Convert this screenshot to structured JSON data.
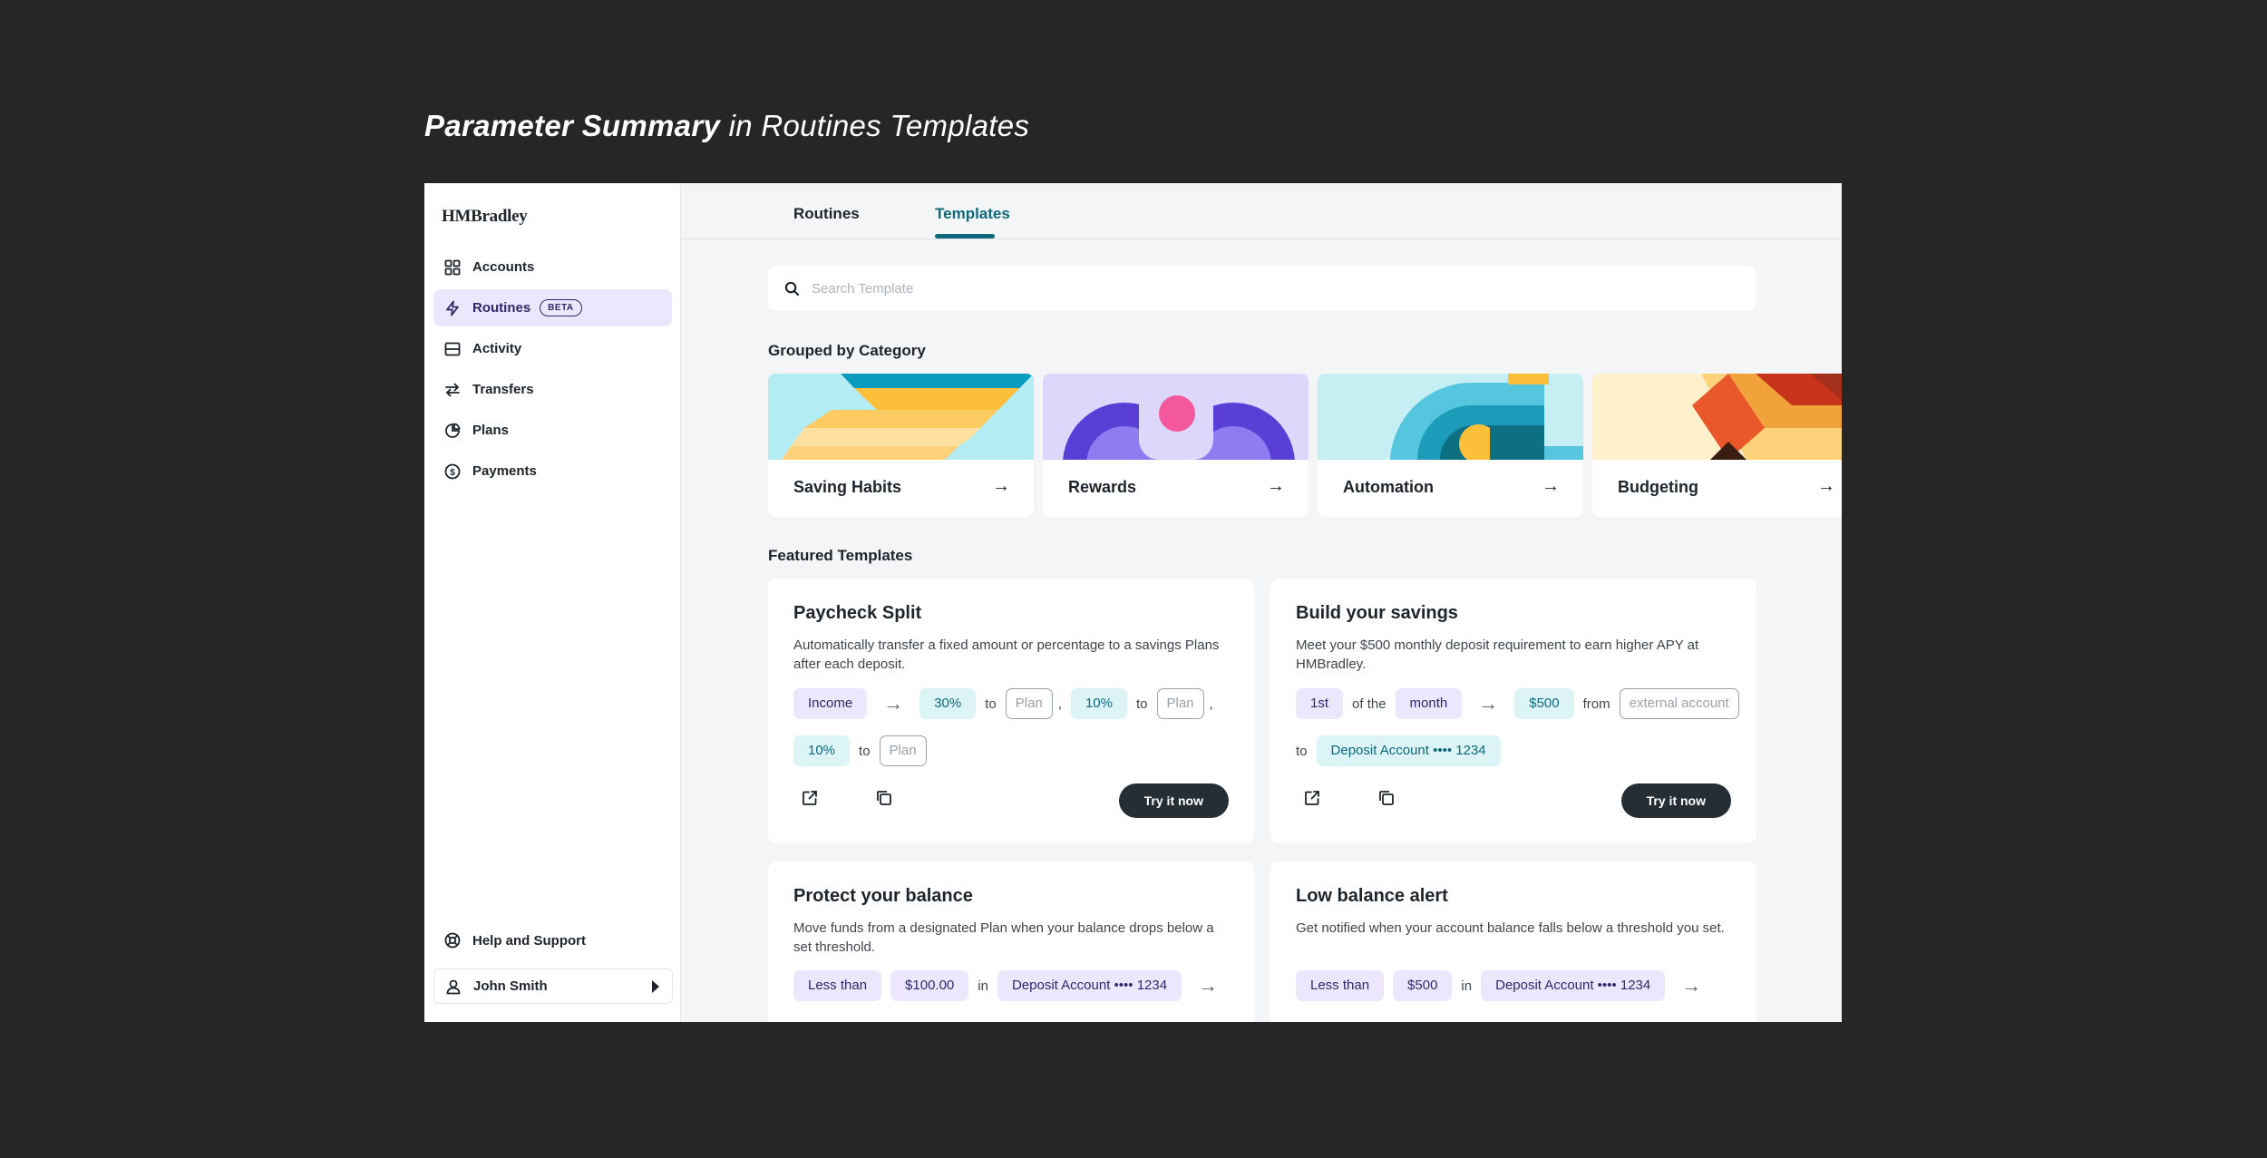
{
  "heading": {
    "strong": "Parameter Summary",
    "light": "in Routines Templates"
  },
  "sidebar": {
    "logo": "HMBradley",
    "items": [
      {
        "label": "Accounts",
        "icon": "grid-icon"
      },
      {
        "label": "Routines",
        "icon": "lightning-icon",
        "badge": "BETA"
      },
      {
        "label": "Activity",
        "icon": "card-icon"
      },
      {
        "label": "Transfers",
        "icon": "transfer-icon"
      },
      {
        "label": "Plans",
        "icon": "pie-icon"
      },
      {
        "label": "Payments",
        "icon": "dollar-circle-icon"
      }
    ],
    "help": "Help and Support",
    "user": "John Smith"
  },
  "tabs": [
    "Routines",
    "Templates"
  ],
  "search": {
    "placeholder": "Search Template"
  },
  "grouped": {
    "title": "Grouped by Category",
    "cards": [
      "Saving Habits",
      "Rewards",
      "Automation",
      "Budgeting"
    ]
  },
  "featured": {
    "title": "Featured Templates",
    "cards": [
      {
        "title": "Paycheck Split",
        "desc": "Automatically transfer a fixed amount or percentage to a savings Plans after each deposit.",
        "row1": [
          "Income",
          "30%",
          "to",
          "Plan",
          ",",
          "10%",
          "to",
          "Plan",
          ","
        ],
        "row2": [
          "10%",
          "to",
          "Plan"
        ],
        "button": "Try it now"
      },
      {
        "title": "Build your savings",
        "desc": "Meet your $500 monthly deposit requirement to earn higher APY at HMBradley.",
        "row1": [
          "1st",
          "of the",
          "month",
          "$500",
          "from",
          "external account"
        ],
        "row2": [
          "to",
          "Deposit Account •••• 1234"
        ],
        "button": "Try it now"
      },
      {
        "title": "Protect your balance",
        "desc": "Move funds from a designated Plan when your balance drops below a set threshold.",
        "row1": [
          "Less than",
          "$100.00",
          "in",
          "Deposit Account •••• 1234"
        ]
      },
      {
        "title": "Low balance alert",
        "desc": "Get notified when your account balance falls below a threshold you set.",
        "row1": [
          "Less than",
          "$500",
          "in",
          "Deposit Account •••• 1234"
        ]
      }
    ]
  },
  "colors": {
    "accent": "#0e6a7a",
    "purple": "#ece7fd",
    "teal": "#ddf4f6",
    "dark": "#252e35"
  }
}
